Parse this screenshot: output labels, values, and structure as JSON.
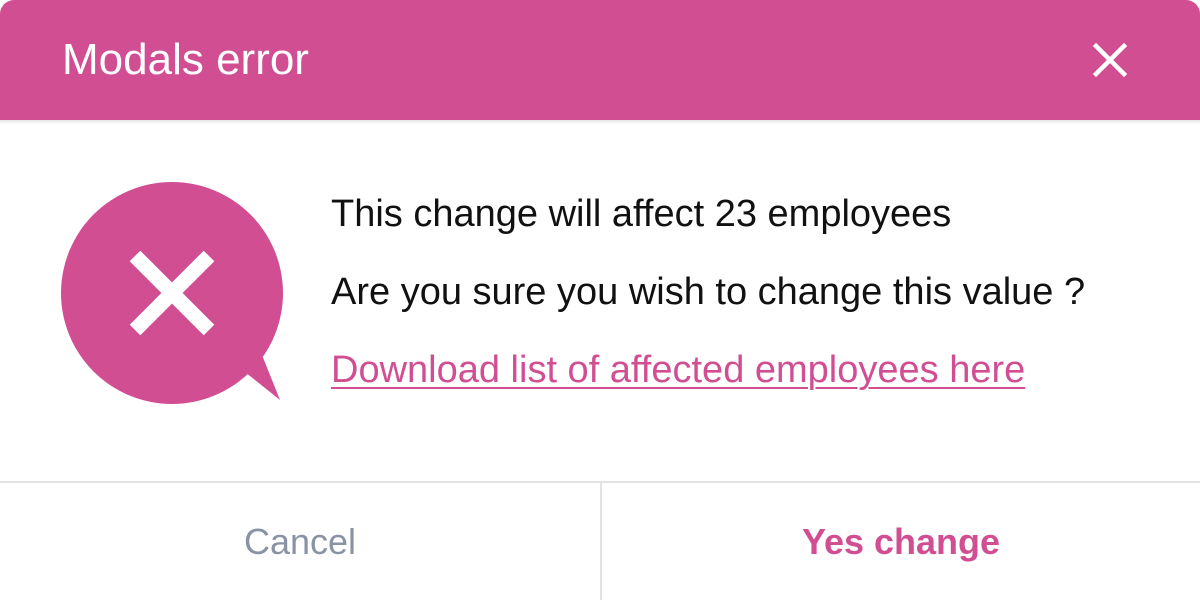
{
  "modal": {
    "title": "Modals error",
    "accent_color": "#d14e93",
    "close_icon": "close-icon",
    "status_icon": "error-speech-bubble-icon"
  },
  "body": {
    "line1": "This change will affect 23 employees",
    "line2": "Are you sure you wish to change this value ?",
    "link_text": "Download list of affected employees here"
  },
  "footer": {
    "cancel_label": "Cancel",
    "confirm_label": "Yes change"
  }
}
